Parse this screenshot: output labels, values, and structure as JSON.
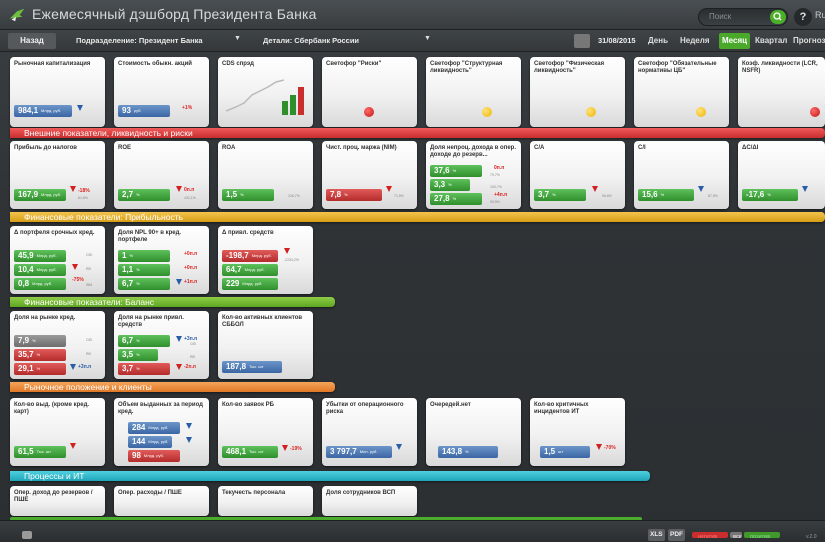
{
  "app": {
    "title": "Ежемесячный дэшборд Президента Банка",
    "search_placeholder": "Поиск",
    "help": "?",
    "right_partial": "Ru"
  },
  "toolbar": {
    "back": "Назад",
    "division": "Подразделение: Президент Банка",
    "details": "Детали: Сбербанк России",
    "date": "31/08/2015",
    "periods": [
      "День",
      "Неделя",
      "Месяц",
      "Квартал",
      "Прогноз"
    ],
    "active_period": "Месяц"
  },
  "sections": [
    {
      "label": "Внешние показатели, ликвидность и риски",
      "color": "#e03c3c"
    },
    {
      "label": "Финансовые показатели: Прибыльность",
      "color": "#e9b22d"
    },
    {
      "label": "Финансовые показатели: Баланс",
      "color": "#77bb37"
    },
    {
      "label": "Рыночное положение и клиенты",
      "color": "#ed8a3a"
    },
    {
      "label": "Процессы и ИТ",
      "color": "#2fbccd"
    }
  ],
  "cards": {
    "r1": [
      {
        "title": "Рыночная капитализация",
        "value": "984,1",
        "unit": "Млрд. руб."
      },
      {
        "title": "Стоимость обыкн. акций",
        "value": "93",
        "unit": "руб.",
        "delta": "+1%"
      },
      {
        "title": "CDS спрэд"
      },
      {
        "title": "Светофор \"Риски\""
      },
      {
        "title": "Светофор \"Структурная ликвидность\""
      },
      {
        "title": "Светофор \"Физическая ликвидность\""
      },
      {
        "title": "Светофор \"Обязательные нормативы ЦБ\""
      },
      {
        "title": "Коэф. ликвидности (LCR, NSFR)"
      }
    ],
    "r2": [
      {
        "title": "Прибыль до налогов",
        "value": "167,9",
        "unit": "Млрд. руб.",
        "delta": "-18%",
        "sub": "61,6%"
      },
      {
        "title": "ROE",
        "value": "2,7",
        "unit": "%",
        "delta": "0п.п",
        "sub": "432,1%"
      },
      {
        "title": "ROA",
        "value": "1,5",
        "unit": "%",
        "sub": "226,7%"
      },
      {
        "title": "Чист. проц. маржа (NIM)",
        "value": "7,8",
        "unit": "%",
        "sub": "71,5%"
      },
      {
        "title": "Доля непроц. дохода в опер. доходе до резерв...",
        "values": [
          "37,6",
          "3,3",
          "27,8"
        ],
        "deltas": [
          "0п.п",
          "+4п.п"
        ],
        "subs": [
          "70,7%",
          "100,7%",
          "59,5%"
        ]
      },
      {
        "title": "C/A",
        "value": "3,7",
        "unit": "%",
        "sub": "96,6%"
      },
      {
        "title": "C/I",
        "value": "15,6",
        "unit": "%",
        "sub": "87,5%"
      },
      {
        "title": "ΔC/ΔI",
        "value": "-17,6",
        "unit": "%"
      }
    ],
    "r3": [
      {
        "title": "Δ портфеля срочных кред.",
        "values": [
          "45,9",
          "10,4",
          "0,8"
        ],
        "unit": "Млрд. руб.",
        "tags": [
          "CIB",
          "RB",
          "WM"
        ],
        "delta": "-75%"
      },
      {
        "title": "Доля NPL 90+ в кред. портфеле",
        "values": [
          "1",
          "1,1",
          "6,7"
        ],
        "unit": "%",
        "deltas": [
          "+0п.п",
          "+0п.п",
          "+1п.п"
        ]
      },
      {
        "title": "Δ привл. средств",
        "values": [
          "-198,7",
          "64,7",
          "229"
        ],
        "unit": "Млрд. руб.",
        "sub": "-2234,2%"
      }
    ],
    "r4": [
      {
        "title": "Доля на рынке кред.",
        "values": [
          "7,9",
          "35,7",
          "29,1"
        ],
        "unit": "%",
        "delta": "+3п.п",
        "tags": [
          "CIB",
          "RB",
          "RB"
        ]
      },
      {
        "title": "Доля на рынке привл. средств",
        "values": [
          "6,7",
          "3,5",
          "3,7"
        ],
        "unit": "%",
        "deltas": [
          "+3п.п",
          "-2п.п"
        ],
        "tags": [
          "CIB",
          "RB",
          "RB"
        ]
      },
      {
        "title": "Кол-во активных клиентов СББОЛ",
        "value": "187,8",
        "unit": "Тыс. шт"
      }
    ],
    "r5": [
      {
        "title": "Кол-во выд. (кроме кред. карт)",
        "value": "61,5",
        "unit": "Тыс. шт"
      },
      {
        "title": "Объем выданных за период кред.",
        "values": [
          "284",
          "144",
          "98"
        ],
        "unit": "Млрд. руб."
      },
      {
        "title": "Кол-во заявок РБ",
        "value": "468,1",
        "unit": "Тыс. шт",
        "delta": "-19%"
      },
      {
        "title": "Убытки от операционного риска",
        "value": "3 797,7",
        "unit": "Млн. руб."
      },
      {
        "title": "Очередей.нет",
        "value": "143,8",
        "unit": "%"
      },
      {
        "title": "Кол-во критичных инцидентов ИТ",
        "value": "1,5",
        "unit": "шт",
        "delta": "-70%"
      }
    ],
    "r6": [
      {
        "title": "Опер. доход до резервов / ПШЕ"
      },
      {
        "title": "Опер. расходы / ПШЕ"
      },
      {
        "title": "Текучесть персонала"
      },
      {
        "title": "Доля сотрудников ВСП"
      }
    ]
  },
  "bottom": {
    "xls": "XLS",
    "pdf": "PDF",
    "legend_neg": "негатив",
    "legend_all": "все",
    "legend_pos": "позитив",
    "version": "v.2.0"
  },
  "colors": {
    "active": "#4aa92b",
    "red": "#d02020",
    "blue": "#2a5da8"
  }
}
